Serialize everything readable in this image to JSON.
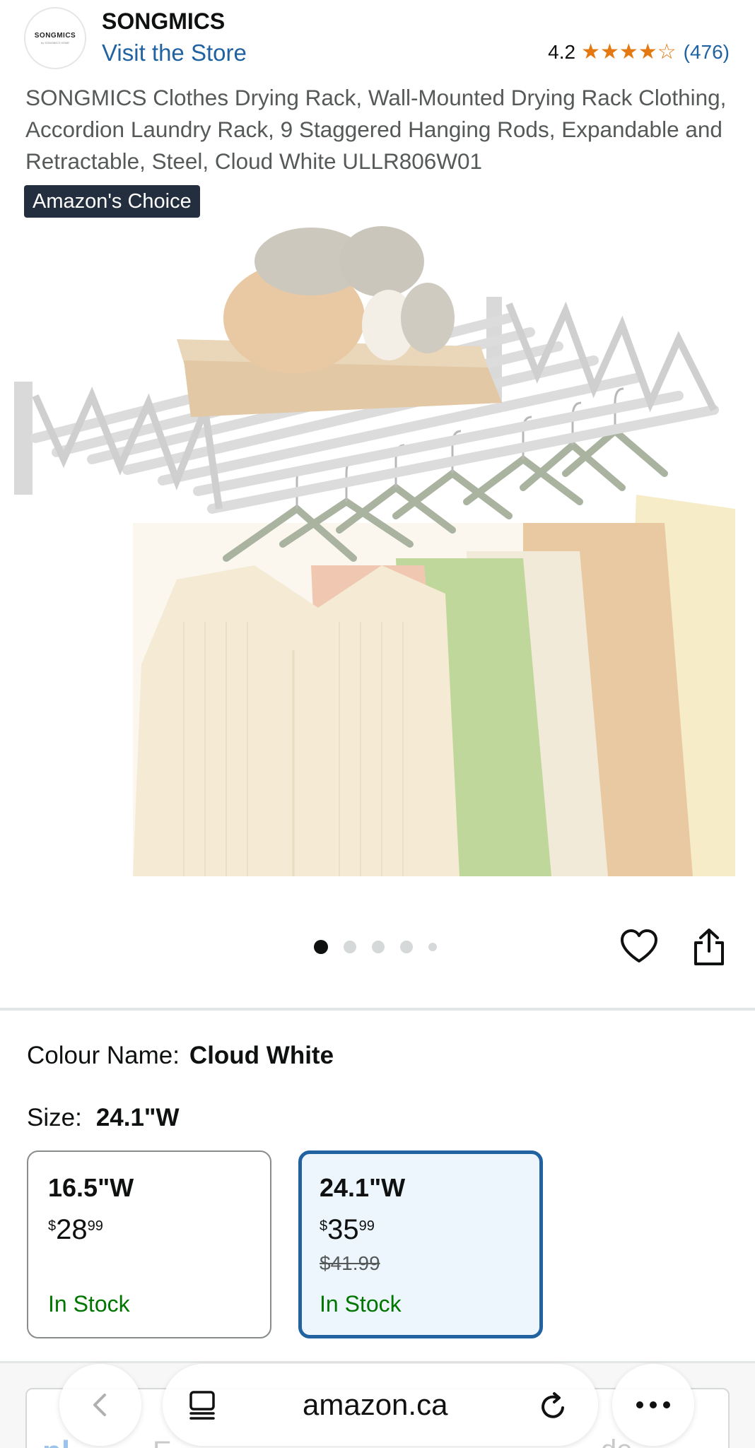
{
  "header": {
    "logo_text": "SONGMICS",
    "logo_sub": "by SONGMICS HOME",
    "brand": "SONGMICS",
    "store_link": "Visit the Store",
    "rating": "4.2",
    "rating_value": 4.2,
    "review_count": "(476)"
  },
  "product": {
    "title": "SONGMICS Clothes Drying Rack, Wall-Mounted Drying Rack Clothing, Accordion Laundry Rack, 9 Staggered Hanging Rods, Expandable and Retractable, Steel, Cloud White ULLR806W01",
    "badge": "Amazon's Choice"
  },
  "gallery": {
    "image_count": 5,
    "active_index": 0
  },
  "options": {
    "colour_label": "Colour Name:",
    "colour_value": "Cloud White",
    "size_label": "Size:",
    "size_value": "24.1\"W",
    "sizes": [
      {
        "label": "16.5\"W",
        "currency": "$",
        "whole": "28",
        "fraction": "99",
        "was": "",
        "stock": "In Stock"
      },
      {
        "label": "24.1\"W",
        "currency": "$",
        "whole": "35",
        "fraction": "99",
        "was": "$41.99",
        "stock": "In Stock"
      }
    ]
  },
  "browser": {
    "url": "amazon.ca",
    "behind_text_1": "pl",
    "behind_text_2": "E",
    "behind_text_3": "de"
  },
  "colors": {
    "link": "#2162a1",
    "star": "#e47911",
    "stock": "#007600",
    "badge_bg": "#232f3e",
    "selected_border": "#2162a1",
    "selected_bg": "#edf6fd"
  }
}
